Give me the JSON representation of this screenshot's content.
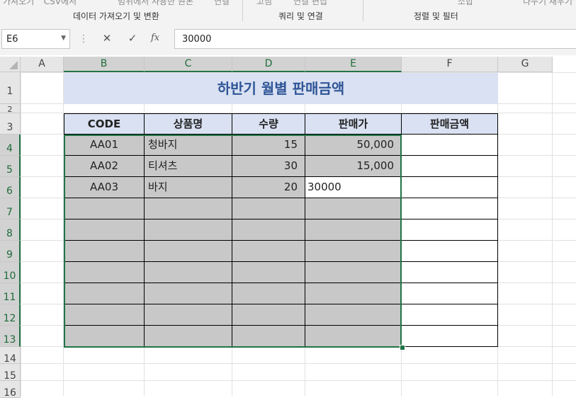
{
  "ribbon": {
    "top_items": [
      "가져오기 ˅ CSV에서",
      "범위에서 사용한 원본",
      "연결",
      "고침 ˅",
      "연결 편집",
      "소합",
      "나누기 채우기"
    ],
    "groups": [
      "데이터 가져오기 및 변환",
      "쿼리 및 연결",
      "정렬 및 필터"
    ]
  },
  "formula_bar": {
    "name_box": "E6",
    "cancel_icon": "✕",
    "enter_icon": "✓",
    "fx_label": "fx",
    "value": "30000"
  },
  "columns": [
    "A",
    "B",
    "C",
    "D",
    "E",
    "F",
    "G"
  ],
  "rows": [
    "1",
    "2",
    "3",
    "4",
    "5",
    "6",
    "7",
    "8",
    "9",
    "10",
    "11",
    "12",
    "13",
    "14",
    "15",
    "16"
  ],
  "sheet": {
    "title": "하반기 월별 판매금액",
    "headers": [
      "CODE",
      "상품명",
      "수량",
      "판매가",
      "판매금액"
    ],
    "data_rows": [
      [
        "AA01",
        "청바지",
        "15",
        "50,000",
        ""
      ],
      [
        "AA02",
        "티셔츠",
        "30",
        "15,000",
        ""
      ],
      [
        "AA03",
        "바지",
        "20",
        "30000",
        ""
      ],
      [
        "",
        "",
        "",
        "",
        ""
      ],
      [
        "",
        "",
        "",
        "",
        ""
      ],
      [
        "",
        "",
        "",
        "",
        ""
      ],
      [
        "",
        "",
        "",
        "",
        ""
      ],
      [
        "",
        "",
        "",
        "",
        ""
      ],
      [
        "",
        "",
        "",
        "",
        ""
      ],
      [
        "",
        "",
        "",
        "",
        ""
      ]
    ]
  },
  "colors": {
    "accent": "#217346",
    "header_fill": "#d9e1f2",
    "title_text": "#2f5597",
    "selection_fill": "#c8c8c8"
  }
}
